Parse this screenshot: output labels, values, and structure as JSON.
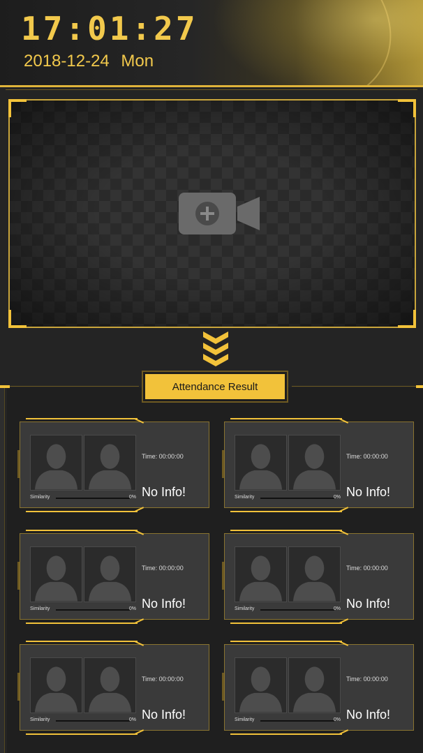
{
  "header": {
    "clock": "17:01:27",
    "date": "2018-12-24  Mon"
  },
  "camera": {
    "icon": "add-camera-icon"
  },
  "result_button": {
    "label": "Attendance Result"
  },
  "cards": [
    {
      "time": "Time: 00:00:00",
      "status": "No Info!",
      "similarity_label": "Similarity",
      "similarity_value": "0%"
    },
    {
      "time": "Time: 00:00:00",
      "status": "No Info!",
      "similarity_label": "Similarity",
      "similarity_value": "0%"
    },
    {
      "time": "Time: 00:00:00",
      "status": "No Info!",
      "similarity_label": "Similarity",
      "similarity_value": "0%"
    },
    {
      "time": "Time: 00:00:00",
      "status": "No Info!",
      "similarity_label": "Similarity",
      "similarity_value": "0%"
    },
    {
      "time": "Time: 00:00:00",
      "status": "No Info!",
      "similarity_label": "Similarity",
      "similarity_value": "0%"
    },
    {
      "time": "Time: 00:00:00",
      "status": "No Info!",
      "similarity_label": "Similarity",
      "similarity_value": "0%"
    }
  ],
  "colors": {
    "accent": "#f2c23a",
    "background": "#242424",
    "card": "#3a3a3a"
  }
}
